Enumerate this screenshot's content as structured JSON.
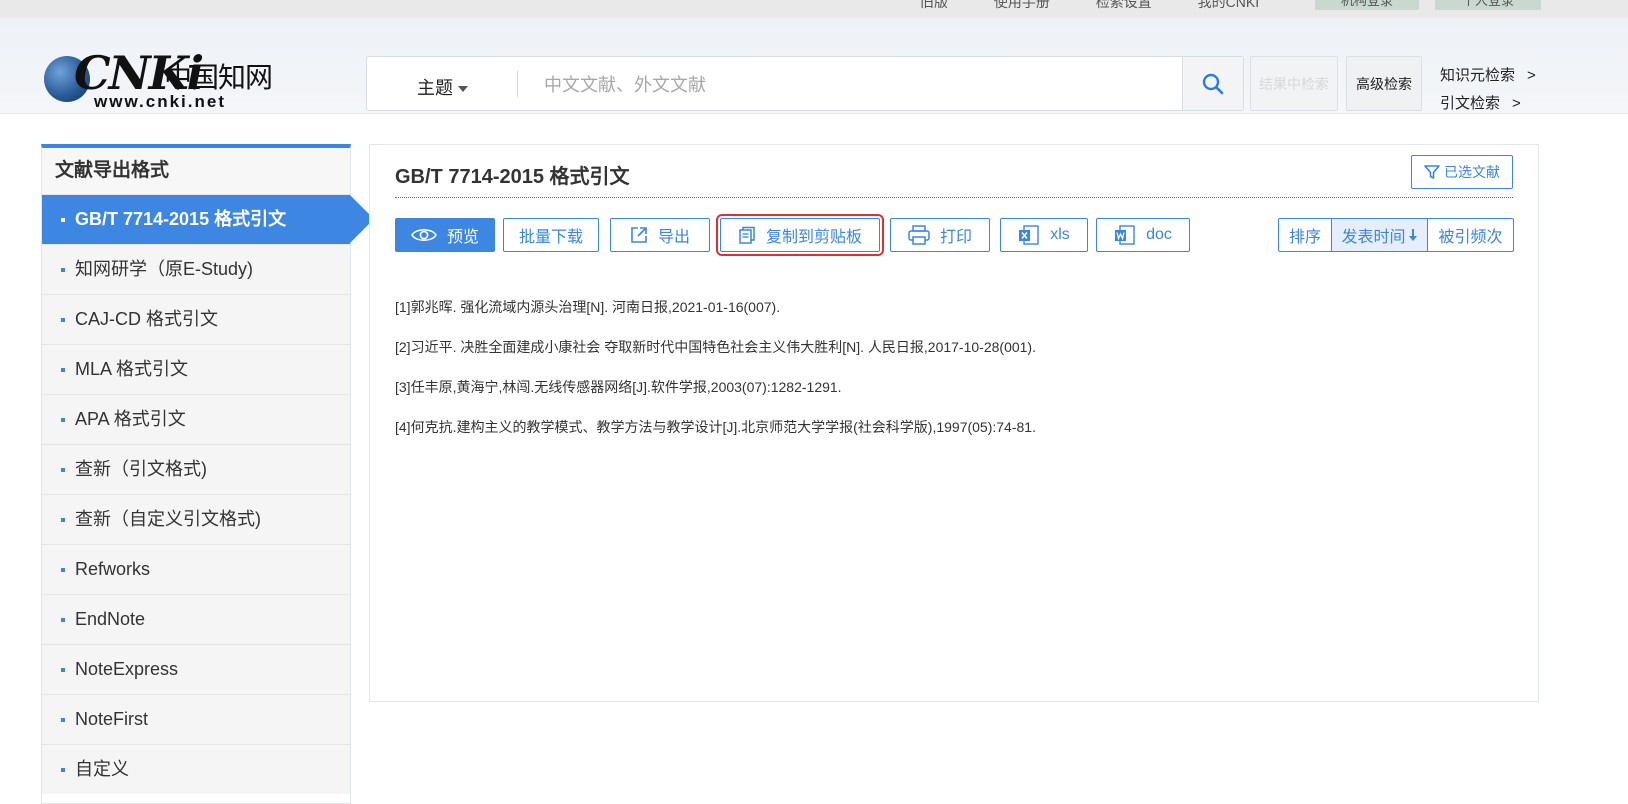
{
  "top": {
    "links": [
      "旧版",
      "使用手册",
      "检索设置",
      "我的CNKI"
    ],
    "buttons": [
      "机构登录",
      "个人登录"
    ]
  },
  "logo": {
    "brand": "CNKi",
    "cn": "中国知网",
    "url": "www.cnki.net"
  },
  "search": {
    "field": "主题",
    "placeholder": "中文文献、外文文献",
    "within_label": "结果中检索",
    "advanced_label": "高级检索"
  },
  "side_links": {
    "knowledge": "知识元检索",
    "citation": "引文检索",
    "arrow": ">"
  },
  "sidebar": {
    "title": "文献导出格式",
    "items": [
      {
        "label": "GB/T 7714-2015 格式引文",
        "active": true
      },
      {
        "label": "知网研学（原E-Study)"
      },
      {
        "label": "CAJ-CD 格式引文"
      },
      {
        "label": "MLA 格式引文"
      },
      {
        "label": "APA 格式引文"
      },
      {
        "label": "查新（引文格式)"
      },
      {
        "label": "查新（自定义引文格式)"
      },
      {
        "label": "Refworks"
      },
      {
        "label": "EndNote"
      },
      {
        "label": "NoteExpress"
      },
      {
        "label": "NoteFirst"
      },
      {
        "label": "自定义"
      }
    ]
  },
  "panel": {
    "title": "GB/T 7714-2015 格式引文",
    "selected_label": "已选文献",
    "toolbar": {
      "preview": "预览",
      "batch_download": "批量下载",
      "export": "导出",
      "copy": "复制到剪贴板",
      "print": "打印",
      "xls": "xls",
      "doc": "doc"
    },
    "sort": {
      "label": "排序",
      "pubtime": "发表时间",
      "cited": "被引频次"
    },
    "refs": [
      "[1]郭兆晖. 强化流域内源头治理[N]. 河南日报,2021-01-16(007).",
      "[2]习近平. 决胜全面建成小康社会 夺取新时代中国特色社会主义伟大胜利[N]. 人民日报,2017-10-28(001).",
      "[3]任丰原,黄海宁,林闯.无线传感器网络[J].软件学报,2003(07):1282-1291.",
      "[4]何克抗.建构主义的教学模式、教学方法与教学设计[J].北京师范大学学报(社会科学版),1997(05):74-81."
    ]
  },
  "colors": {
    "accent": "#3d87e2",
    "highlight": "#e02f2f"
  }
}
